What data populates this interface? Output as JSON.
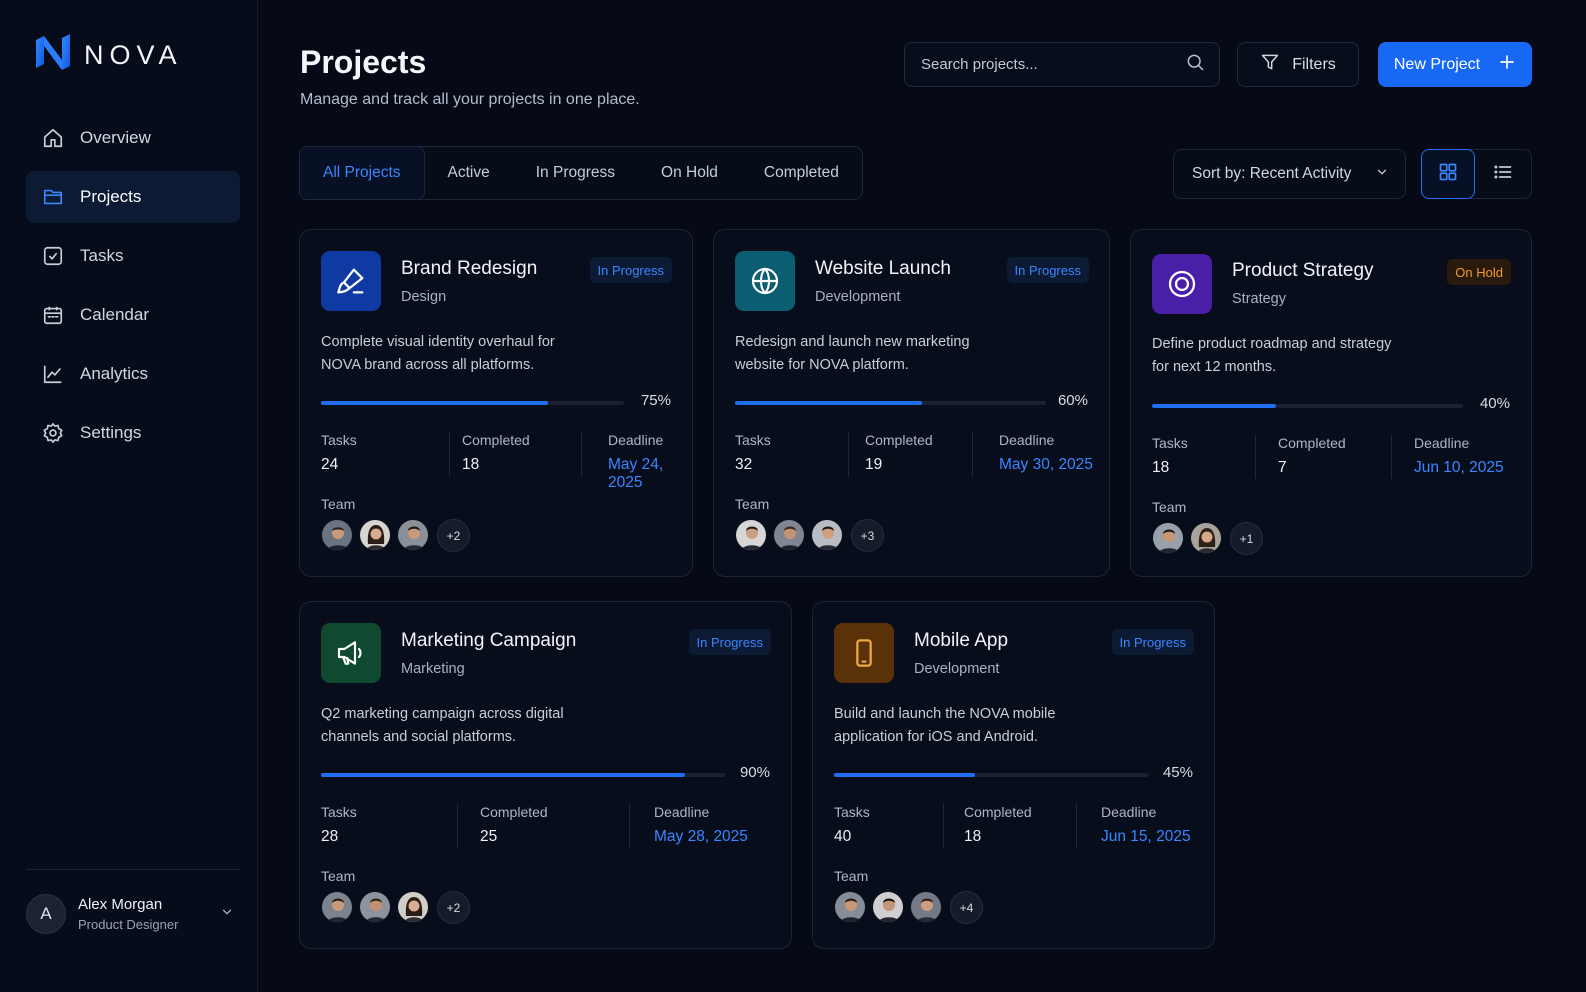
{
  "brand": {
    "name": "NOVA",
    "accent": "#1f6df0"
  },
  "sidebar": {
    "items": [
      {
        "label": "Overview",
        "icon": "home-icon"
      },
      {
        "label": "Projects",
        "icon": "folder-icon",
        "active": true
      },
      {
        "label": "Tasks",
        "icon": "checkbox-icon"
      },
      {
        "label": "Calendar",
        "icon": "calendar-icon"
      },
      {
        "label": "Analytics",
        "icon": "chart-icon"
      },
      {
        "label": "Settings",
        "icon": "gear-icon"
      }
    ],
    "user": {
      "initial": "A",
      "name": "Alex Morgan",
      "role": "Product Designer"
    }
  },
  "header": {
    "title": "Projects",
    "subtitle": "Manage and track all your projects in one place.",
    "search_placeholder": "Search projects...",
    "filters_label": "Filters",
    "new_project_label": "New Project"
  },
  "tabs": [
    "All Projects",
    "Active",
    "In Progress",
    "On Hold",
    "Completed"
  ],
  "sort": {
    "label": "Sort by: Recent Activity"
  },
  "labels": {
    "tasks": "Tasks",
    "completed": "Completed",
    "deadline": "Deadline",
    "team": "Team"
  },
  "projects": [
    {
      "title": "Brand Redesign",
      "category": "Design",
      "status": "In Progress",
      "description": "Complete visual identity overhaul for NOVA brand across all platforms.",
      "progress": 75,
      "progress_label": "75%",
      "tasks": "24",
      "completed": "18",
      "deadline": "May 24, 2025",
      "team_more": "+2",
      "icon": "brush-icon",
      "icon_bg": "#0f3aa3"
    },
    {
      "title": "Website Launch",
      "category": "Development",
      "status": "In Progress",
      "description": "Redesign and launch new marketing website for NOVA platform.",
      "progress": 60,
      "progress_label": "60%",
      "tasks": "32",
      "completed": "19",
      "deadline": "May 30, 2025",
      "team_more": "+3",
      "icon": "globe-icon",
      "icon_bg": "#0b5e72"
    },
    {
      "title": "Product Strategy",
      "category": "Strategy",
      "status": "On Hold",
      "description": "Define product roadmap and strategy for next 12 months.",
      "progress": 40,
      "progress_label": "40%",
      "tasks": "18",
      "completed": "7",
      "deadline": "Jun 10, 2025",
      "team_more": "+1",
      "icon": "target-icon",
      "icon_bg": "#4a1fa8"
    },
    {
      "title": "Marketing Campaign",
      "category": "Marketing",
      "status": "In Progress",
      "description": "Q2 marketing campaign across digital channels and social platforms.",
      "progress": 90,
      "progress_label": "90%",
      "tasks": "28",
      "completed": "25",
      "deadline": "May 28, 2025",
      "team_more": "+2",
      "icon": "megaphone-icon",
      "icon_bg": "#0f4a30"
    },
    {
      "title": "Mobile App",
      "category": "Development",
      "status": "In Progress",
      "description": "Build and launch the NOVA mobile application for iOS and Android.",
      "progress": 45,
      "progress_label": "45%",
      "tasks": "40",
      "completed": "18",
      "deadline": "Jun 15, 2025",
      "team_more": "+4",
      "icon": "phone-icon",
      "icon_bg": "#5a3208"
    }
  ]
}
